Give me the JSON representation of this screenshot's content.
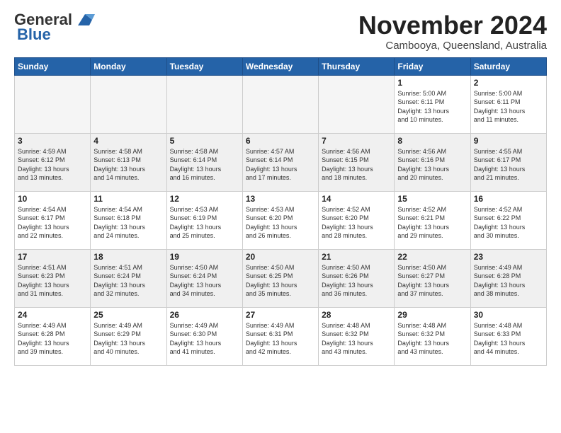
{
  "logo": {
    "line1": "General",
    "line2": "Blue"
  },
  "title": "November 2024",
  "location": "Cambooya, Queensland, Australia",
  "weekdays": [
    "Sunday",
    "Monday",
    "Tuesday",
    "Wednesday",
    "Thursday",
    "Friday",
    "Saturday"
  ],
  "weeks": [
    [
      {
        "day": "",
        "info": ""
      },
      {
        "day": "",
        "info": ""
      },
      {
        "day": "",
        "info": ""
      },
      {
        "day": "",
        "info": ""
      },
      {
        "day": "",
        "info": ""
      },
      {
        "day": "1",
        "info": "Sunrise: 5:00 AM\nSunset: 6:11 PM\nDaylight: 13 hours\nand 10 minutes."
      },
      {
        "day": "2",
        "info": "Sunrise: 5:00 AM\nSunset: 6:11 PM\nDaylight: 13 hours\nand 11 minutes."
      }
    ],
    [
      {
        "day": "3",
        "info": "Sunrise: 4:59 AM\nSunset: 6:12 PM\nDaylight: 13 hours\nand 13 minutes."
      },
      {
        "day": "4",
        "info": "Sunrise: 4:58 AM\nSunset: 6:13 PM\nDaylight: 13 hours\nand 14 minutes."
      },
      {
        "day": "5",
        "info": "Sunrise: 4:58 AM\nSunset: 6:14 PM\nDaylight: 13 hours\nand 16 minutes."
      },
      {
        "day": "6",
        "info": "Sunrise: 4:57 AM\nSunset: 6:14 PM\nDaylight: 13 hours\nand 17 minutes."
      },
      {
        "day": "7",
        "info": "Sunrise: 4:56 AM\nSunset: 6:15 PM\nDaylight: 13 hours\nand 18 minutes."
      },
      {
        "day": "8",
        "info": "Sunrise: 4:56 AM\nSunset: 6:16 PM\nDaylight: 13 hours\nand 20 minutes."
      },
      {
        "day": "9",
        "info": "Sunrise: 4:55 AM\nSunset: 6:17 PM\nDaylight: 13 hours\nand 21 minutes."
      }
    ],
    [
      {
        "day": "10",
        "info": "Sunrise: 4:54 AM\nSunset: 6:17 PM\nDaylight: 13 hours\nand 22 minutes."
      },
      {
        "day": "11",
        "info": "Sunrise: 4:54 AM\nSunset: 6:18 PM\nDaylight: 13 hours\nand 24 minutes."
      },
      {
        "day": "12",
        "info": "Sunrise: 4:53 AM\nSunset: 6:19 PM\nDaylight: 13 hours\nand 25 minutes."
      },
      {
        "day": "13",
        "info": "Sunrise: 4:53 AM\nSunset: 6:20 PM\nDaylight: 13 hours\nand 26 minutes."
      },
      {
        "day": "14",
        "info": "Sunrise: 4:52 AM\nSunset: 6:20 PM\nDaylight: 13 hours\nand 28 minutes."
      },
      {
        "day": "15",
        "info": "Sunrise: 4:52 AM\nSunset: 6:21 PM\nDaylight: 13 hours\nand 29 minutes."
      },
      {
        "day": "16",
        "info": "Sunrise: 4:52 AM\nSunset: 6:22 PM\nDaylight: 13 hours\nand 30 minutes."
      }
    ],
    [
      {
        "day": "17",
        "info": "Sunrise: 4:51 AM\nSunset: 6:23 PM\nDaylight: 13 hours\nand 31 minutes."
      },
      {
        "day": "18",
        "info": "Sunrise: 4:51 AM\nSunset: 6:24 PM\nDaylight: 13 hours\nand 32 minutes."
      },
      {
        "day": "19",
        "info": "Sunrise: 4:50 AM\nSunset: 6:24 PM\nDaylight: 13 hours\nand 34 minutes."
      },
      {
        "day": "20",
        "info": "Sunrise: 4:50 AM\nSunset: 6:25 PM\nDaylight: 13 hours\nand 35 minutes."
      },
      {
        "day": "21",
        "info": "Sunrise: 4:50 AM\nSunset: 6:26 PM\nDaylight: 13 hours\nand 36 minutes."
      },
      {
        "day": "22",
        "info": "Sunrise: 4:50 AM\nSunset: 6:27 PM\nDaylight: 13 hours\nand 37 minutes."
      },
      {
        "day": "23",
        "info": "Sunrise: 4:49 AM\nSunset: 6:28 PM\nDaylight: 13 hours\nand 38 minutes."
      }
    ],
    [
      {
        "day": "24",
        "info": "Sunrise: 4:49 AM\nSunset: 6:28 PM\nDaylight: 13 hours\nand 39 minutes."
      },
      {
        "day": "25",
        "info": "Sunrise: 4:49 AM\nSunset: 6:29 PM\nDaylight: 13 hours\nand 40 minutes."
      },
      {
        "day": "26",
        "info": "Sunrise: 4:49 AM\nSunset: 6:30 PM\nDaylight: 13 hours\nand 41 minutes."
      },
      {
        "day": "27",
        "info": "Sunrise: 4:49 AM\nSunset: 6:31 PM\nDaylight: 13 hours\nand 42 minutes."
      },
      {
        "day": "28",
        "info": "Sunrise: 4:48 AM\nSunset: 6:32 PM\nDaylight: 13 hours\nand 43 minutes."
      },
      {
        "day": "29",
        "info": "Sunrise: 4:48 AM\nSunset: 6:32 PM\nDaylight: 13 hours\nand 43 minutes."
      },
      {
        "day": "30",
        "info": "Sunrise: 4:48 AM\nSunset: 6:33 PM\nDaylight: 13 hours\nand 44 minutes."
      }
    ]
  ]
}
